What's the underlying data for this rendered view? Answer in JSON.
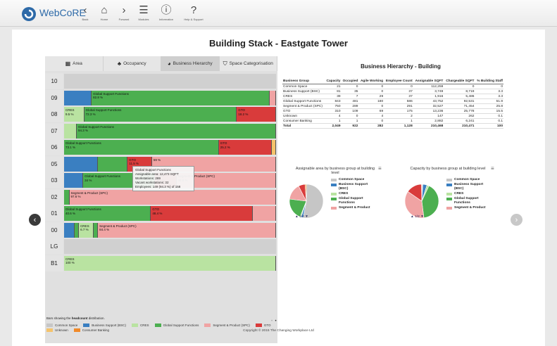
{
  "app": {
    "name": "WebCoRE"
  },
  "nav": [
    {
      "label": "Back",
      "icon": "back-icon",
      "glyph": "‹"
    },
    {
      "label": "Home",
      "icon": "home-icon",
      "glyph": "⌂"
    },
    {
      "label": "Forward",
      "icon": "forward-icon",
      "glyph": "›"
    },
    {
      "label": "Modules",
      "icon": "menu-icon",
      "glyph": "☰"
    },
    {
      "label": "Information",
      "icon": "info-icon",
      "glyph": "ⓘ"
    },
    {
      "label": "Help & Support",
      "icon": "help-icon",
      "glyph": "?"
    }
  ],
  "page": {
    "title": "Building Stack - Eastgate Tower"
  },
  "tabs": [
    {
      "label": "Area",
      "icon": "building-icon",
      "glyph": "▦"
    },
    {
      "label": "Occupancy",
      "icon": "people-icon",
      "glyph": "♣"
    },
    {
      "label": "Business Hierarchy",
      "icon": "pie-icon",
      "glyph": "◕"
    },
    {
      "label": "Space Categorisation",
      "icon": "tag-icon",
      "glyph": "⛉"
    }
  ],
  "colors": {
    "common": "#c6c6c6",
    "bsc": "#3a7fc1",
    "cres": "#b9e3a1",
    "gsf": "#4caf50",
    "sp": "#f0a3a3",
    "gto": "#d93b3b",
    "unknown": "#f5c36b",
    "consumer": "#f08a2a"
  },
  "floors": [
    {
      "name": "10",
      "segments": []
    },
    {
      "name": "09",
      "segments": [
        {
          "c": "bsc",
          "w": 0.13
        },
        {
          "c": "gsf",
          "w": 0.84,
          "label": "Global Support Functions\n82.8 %"
        },
        {
          "c": "sp",
          "w": 0.03
        }
      ]
    },
    {
      "name": "08",
      "segments": [
        {
          "c": "cres",
          "w": 0.095,
          "label": "CRES\n9.5 %"
        },
        {
          "c": "gsf",
          "w": 0.72,
          "label": "Global Support Functions\n72.3 %"
        },
        {
          "c": "gto",
          "w": 0.185,
          "label": "GTO\n18.2 %"
        }
      ]
    },
    {
      "name": "07",
      "segments": [
        {
          "c": "cres",
          "w": 0.06
        },
        {
          "c": "gsf",
          "w": 0.94,
          "label": "Global Support Functions\n94.3 %"
        }
      ]
    },
    {
      "name": "06",
      "segments": [
        {
          "c": "gsf",
          "w": 0.73,
          "label": "Global Support Functions\n73.1 %"
        },
        {
          "c": "gto",
          "w": 0.25,
          "label": "GTO\n25.2 %"
        },
        {
          "c": "unknown",
          "w": 0.02
        }
      ]
    },
    {
      "name": "05",
      "segments": [
        {
          "c": "bsc",
          "w": 0.16
        },
        {
          "c": "common",
          "w": 0.0
        },
        {
          "c": "gsf",
          "w": 0.14
        },
        {
          "c": "gto",
          "w": 0.115,
          "label": "GTO\n11.5 %"
        },
        {
          "c": "sp",
          "w": 0.585,
          "label": "\n59 %"
        }
      ]
    },
    {
      "name": "03",
      "segments": [
        {
          "c": "bsc",
          "w": 0.09
        },
        {
          "c": "gsf",
          "w": 0.34,
          "label": "Global Support Functions\n34 %"
        },
        {
          "c": "gto",
          "w": 0.1,
          "label": "GTO\n9.9 %"
        },
        {
          "c": "sp",
          "w": 0.47,
          "label": "Segment & Product (SPC)\n46.8 %"
        }
      ]
    },
    {
      "name": "02",
      "segments": [
        {
          "c": "gsf",
          "w": 0.025
        },
        {
          "c": "sp",
          "w": 0.975,
          "label": "Segment & Product (SPC)\n97.6 %"
        }
      ]
    },
    {
      "name": "01",
      "segments": [
        {
          "c": "gsf",
          "w": 0.41,
          "label": "Global Support Functions\n40.6 %"
        },
        {
          "c": "gto",
          "w": 0.48,
          "label": "GTO\n48.4 %"
        },
        {
          "c": "sp",
          "w": 0.11
        }
      ]
    },
    {
      "name": "00",
      "segments": [
        {
          "c": "bsc",
          "w": 0.05
        },
        {
          "c": "gsf",
          "w": 0.02
        },
        {
          "c": "cres",
          "w": 0.07,
          "label": "CRES\n6.7 %"
        },
        {
          "c": "gsf",
          "w": 0.02
        },
        {
          "c": "sp",
          "w": 0.84,
          "label": "Segment & Product (SPC)\n84.4 %"
        }
      ]
    },
    {
      "name": "LG",
      "segments": []
    },
    {
      "name": "B1",
      "segments": [
        {
          "c": "cres",
          "w": 1.0,
          "label": "CRES\n100 %"
        }
      ]
    }
  ],
  "tooltip": {
    "title": "Global Support Functions",
    "lines": [
      "Assignable area: 12,473 SQFT",
      "Workstations: 269",
      "Vacant workstations: 32",
      "Employees: 149 (94.3 %) of 158"
    ]
  },
  "stack_note": {
    "prefix": "Bars showing the ",
    "strong": "headcount",
    "suffix": " distribution."
  },
  "legend": [
    {
      "label": "Common Space",
      "c": "common"
    },
    {
      "label": "Business Support (BSC)",
      "c": "bsc"
    },
    {
      "label": "CRES",
      "c": "cres"
    },
    {
      "label": "Global Support Functions",
      "c": "gsf"
    },
    {
      "label": "Segment & Product (SPC)",
      "c": "sp"
    },
    {
      "label": "GTO",
      "c": "gto"
    },
    {
      "label": "Unknown",
      "c": "unknown"
    },
    {
      "label": "Consumer Banking",
      "c": "consumer"
    }
  ],
  "hierarchy": {
    "title": "Business Hierarchy - Building",
    "columns": [
      "Business Group",
      "Capacity",
      "Occupied",
      "Agile Working",
      "Employee Count",
      "Assignable SQFT",
      "Chargeable SQFT",
      "% Building Staff"
    ],
    "rows": [
      [
        "Common Space",
        "21",
        "0",
        "0",
        "0",
        "112,259",
        "0",
        "0"
      ],
      [
        "Business Support (BSC)",
        "81",
        "35",
        "0",
        "37",
        "3,749",
        "8,719",
        "3.3"
      ],
      [
        "CRES",
        "39",
        "7",
        "29",
        "37",
        "1,916",
        "5,486",
        "3.3"
      ],
      [
        "Global Support Functions",
        "843",
        "481",
        "180",
        "586",
        "43,752",
        "92,531",
        "51.9"
      ],
      [
        "Segment & Product (SPC)",
        "750",
        "289",
        "0",
        "291",
        "32,527",
        "71,454",
        "25.8"
      ],
      [
        "GTO",
        "310",
        "109",
        "69",
        "175",
        "13,236",
        "25,778",
        "15.5"
      ],
      [
        "Unknown",
        "4",
        "0",
        "4",
        "2",
        "147",
        "262",
        "0.1"
      ],
      [
        "Consumer Banking",
        "1",
        "1",
        "0",
        "1",
        "2,882",
        "6,241",
        "0.1"
      ]
    ],
    "total": [
      "Total",
      "2,049",
      "922",
      "282",
      "1,128",
      "210,468",
      "210,471",
      "100"
    ]
  },
  "pies": [
    {
      "title": "Assignable area by business group at building level",
      "legend": [
        "Common Space",
        "Business Support (BSC)",
        "CRES",
        "Global Support Functions",
        "Segment & Product"
      ],
      "legend_colors": [
        "common",
        "bsc",
        "cres",
        "gsf",
        "sp"
      ],
      "pager": "1/2",
      "slices": [
        {
          "c": "common",
          "v": 0.53
        },
        {
          "c": "bsc",
          "v": 0.02
        },
        {
          "c": "cres",
          "v": 0.01
        },
        {
          "c": "gsf",
          "v": 0.21
        },
        {
          "c": "sp",
          "v": 0.155
        },
        {
          "c": "gto",
          "v": 0.063
        },
        {
          "c": "consumer",
          "v": 0.012
        }
      ]
    },
    {
      "title": "Capacity by business group at building level",
      "legend": [
        "Common Space",
        "Business Support (BSC)",
        "CRES",
        "Global Support Functions",
        "Segment & Product"
      ],
      "legend_colors": [
        "common",
        "bsc",
        "cres",
        "gsf",
        "sp"
      ],
      "pager": "1/2",
      "slices": [
        {
          "c": "common",
          "v": 0.01
        },
        {
          "c": "bsc",
          "v": 0.04
        },
        {
          "c": "cres",
          "v": 0.02
        },
        {
          "c": "gsf",
          "v": 0.41
        },
        {
          "c": "sp",
          "v": 0.366
        },
        {
          "c": "gto",
          "v": 0.151
        },
        {
          "c": "unknown",
          "v": 0.002
        },
        {
          "c": "consumer",
          "v": 0.001
        }
      ]
    }
  ],
  "footer": {
    "copyright": "Copyright © 2015 The Changing Workplace Ltd"
  }
}
